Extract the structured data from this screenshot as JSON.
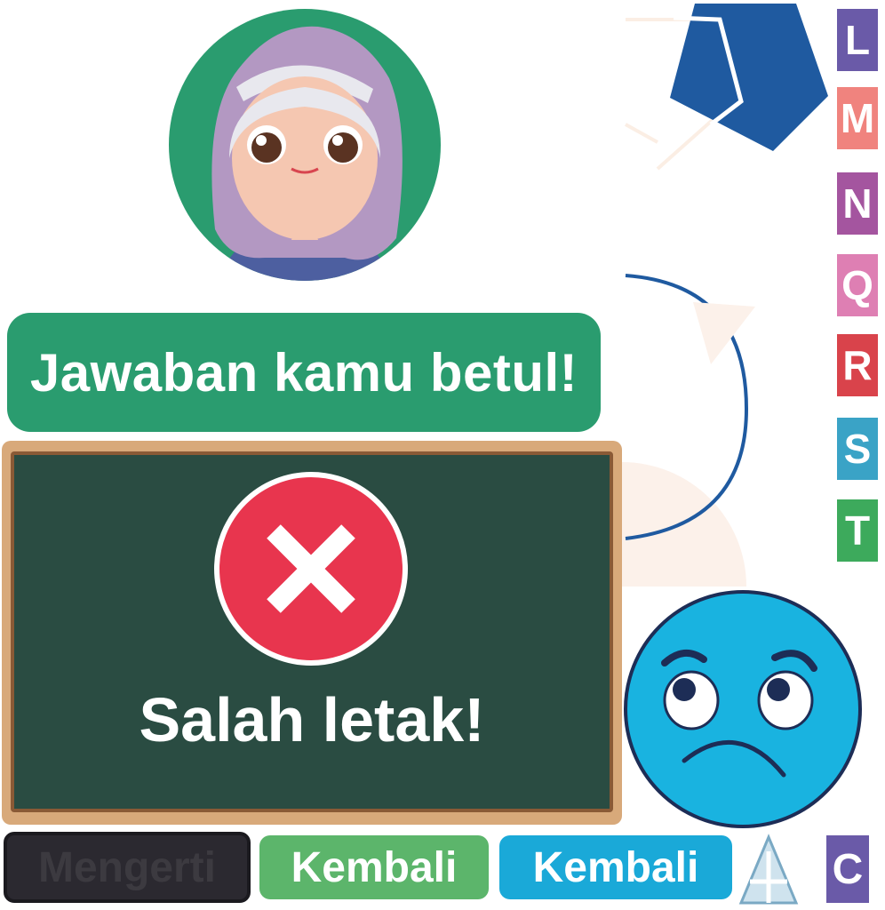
{
  "feedback": {
    "success_message": "Jawaban kamu betul!",
    "wrong_message": "Salah letak!"
  },
  "buttons": {
    "understand_label": "Mengerti",
    "back_label_green": "Kembali",
    "back_label_blue": "Kembali"
  },
  "letter_tiles": [
    {
      "letter": "L",
      "color": "#6a5aa8"
    },
    {
      "letter": "M",
      "color": "#f0837e"
    },
    {
      "letter": "N",
      "color": "#a4559f"
    },
    {
      "letter": "Q",
      "color": "#de7fb3"
    },
    {
      "letter": "R",
      "color": "#d9434b"
    },
    {
      "letter": "S",
      "color": "#3aa3c6"
    },
    {
      "letter": "T",
      "color": "#3daa5c"
    }
  ],
  "corner_tile": {
    "letter": "C",
    "color": "#6a5aa8"
  },
  "colors": {
    "banner": "#2a9c6f",
    "wrong_circle": "#e8354e",
    "chalkboard": "#2a4c42",
    "sad_face": "#19b3e0"
  },
  "icons": {
    "avatar": "hijab-girl-avatar",
    "wrong": "x-circle-icon",
    "sad_face": "worried-face-icon",
    "pentagon": "pentagon-shape-icon",
    "arrow": "curved-arrow-icon",
    "triangle": "triangle-shape-icon"
  }
}
